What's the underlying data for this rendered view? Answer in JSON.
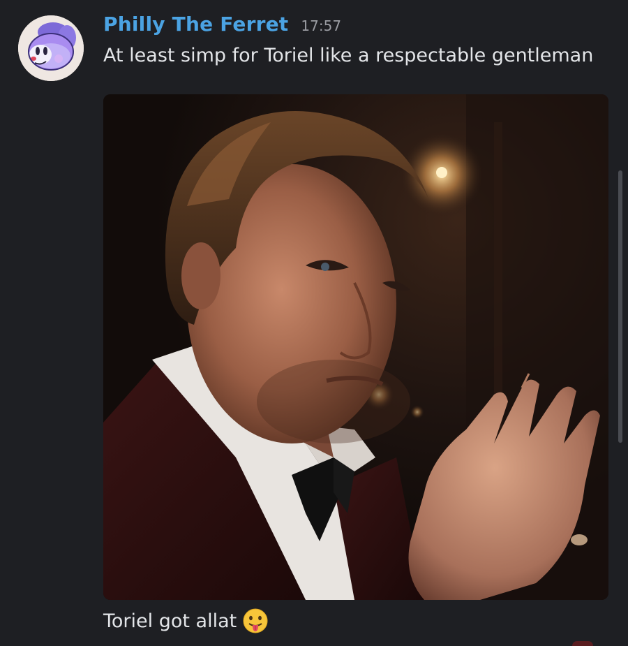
{
  "message": {
    "author": {
      "name": "Philly The Ferret",
      "name_color": "#4ba3e3",
      "avatar_icon": "ferret-avatar"
    },
    "timestamp": "17:57",
    "text": "At least simp for Toriel like a respectable gentleman",
    "attachment": {
      "type": "image",
      "icon": "photo-attachment"
    }
  },
  "followup": {
    "text": "Toriel got allat",
    "emoji": "face-with-tongue-emoji"
  },
  "theme": {
    "background": "#1e1f23",
    "text": "#e3e5e8",
    "muted": "#9a9ca2"
  }
}
